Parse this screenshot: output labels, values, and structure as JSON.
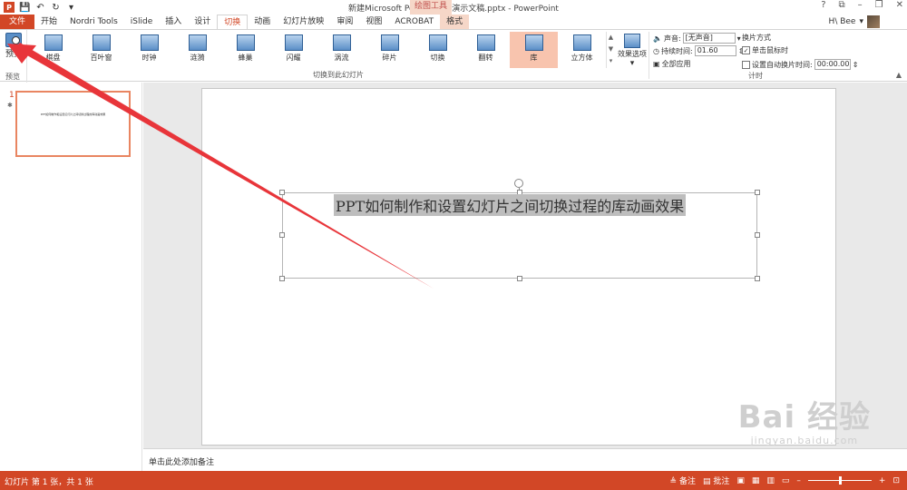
{
  "app": {
    "window_title": "新建Microsoft PowerPoint 演示文稿.pptx - PowerPoint",
    "logo_letter": "P",
    "drawing_tools_label": "绘图工具",
    "window_controls": [
      "?",
      "⧉",
      "–",
      "❐",
      "✕"
    ]
  },
  "qat": {
    "save_glyph": "💾",
    "undo_glyph": "↶",
    "redo_glyph": "↻",
    "customize_glyph": "▾"
  },
  "tabs": [
    {
      "label": "文件"
    },
    {
      "label": "开始"
    },
    {
      "label": "Nordri Tools"
    },
    {
      "label": "iSlide"
    },
    {
      "label": "插入"
    },
    {
      "label": "设计"
    },
    {
      "label": "切换"
    },
    {
      "label": "动画"
    },
    {
      "label": "幻灯片放映"
    },
    {
      "label": "审阅"
    },
    {
      "label": "视图"
    },
    {
      "label": "ACROBAT"
    },
    {
      "label": "格式"
    }
  ],
  "active_tab": "切换",
  "user": {
    "name": "H\\ Bee"
  },
  "ribbon": {
    "preview_group": {
      "button_label": "预览",
      "group_label": "预览"
    },
    "transitions_group": {
      "group_label": "切换到此幻灯片",
      "items": [
        {
          "label": "棋盘"
        },
        {
          "label": "百叶窗"
        },
        {
          "label": "时钟"
        },
        {
          "label": "涟漪"
        },
        {
          "label": "蜂巢"
        },
        {
          "label": "闪耀"
        },
        {
          "label": "涡流"
        },
        {
          "label": "碎片"
        },
        {
          "label": "切换"
        },
        {
          "label": "翻转"
        },
        {
          "label": "库"
        },
        {
          "label": "立方体"
        }
      ],
      "selected": "库",
      "effect_options_label": "效果选项"
    },
    "timing_group": {
      "group_label": "计时",
      "sound_label": "声音:",
      "sound_value": "[无声音]",
      "duration_label": "持续时间:",
      "duration_value": "01.60",
      "apply_all_label": "全部应用",
      "advance_label": "换片方式",
      "on_click_label": "单击鼠标时",
      "on_click_checked": true,
      "after_label": "设置自动换片时间:",
      "after_checked": false,
      "after_value": "00:00.00"
    }
  },
  "thumbnails": [
    {
      "number": "1",
      "star": "✱",
      "text": "PPT如何制作和设置幻灯片之间切换过程的库动画效果"
    }
  ],
  "slide": {
    "title": "PPT如何制作和设置幻灯片之间切换过程的库动画效果"
  },
  "notes_placeholder": "单击此处添加备注",
  "status": {
    "slide_info": "幻灯片 第 1 张，共 1 张",
    "notes_label": "备注",
    "comments_label": "批注"
  },
  "watermark": {
    "main": "Bai 经验",
    "sub": "jingyan.baidu.com"
  },
  "colors": {
    "accent": "#d24726",
    "selected_transition": "#f8c4ae",
    "annotation_arrow": "#e8353a"
  }
}
